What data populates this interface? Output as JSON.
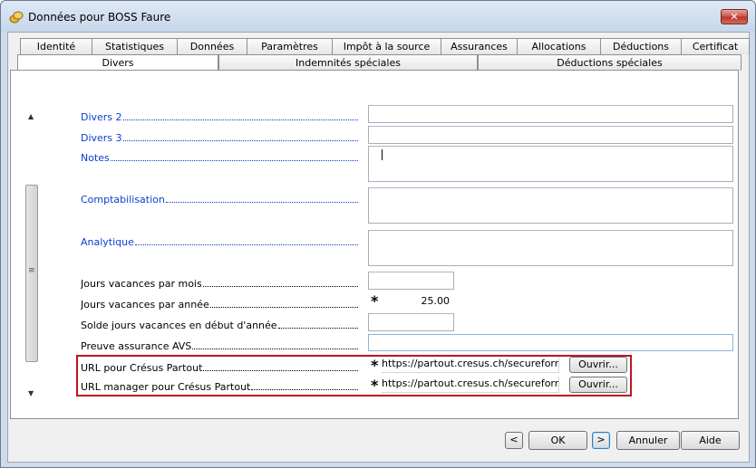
{
  "window": {
    "title": "Données pour BOSS Faure",
    "close_label": "✕"
  },
  "tabs_row1": [
    {
      "label": "Identité"
    },
    {
      "label": "Statistiques"
    },
    {
      "label": "Données"
    },
    {
      "label": "Paramètres"
    },
    {
      "label": "Impôt à la source"
    },
    {
      "label": "Assurances"
    },
    {
      "label": "Allocations"
    },
    {
      "label": "Déductions"
    },
    {
      "label": "Certificat"
    }
  ],
  "tabs_row2": [
    {
      "label": "Divers",
      "active": true
    },
    {
      "label": "Indemnités spéciales"
    },
    {
      "label": "Déductions spéciales"
    }
  ],
  "fields": {
    "divers2": {
      "label": "Divers 2",
      "value": ""
    },
    "divers3": {
      "label": "Divers 3",
      "value": ""
    },
    "notes": {
      "label": "Notes",
      "value": ""
    },
    "comptabilisation": {
      "label": "Comptabilisation",
      "value": ""
    },
    "analytique": {
      "label": "Analytique",
      "value": ""
    },
    "jours_mois": {
      "label": "Jours vacances par mois",
      "value": ""
    },
    "jours_annee": {
      "label": "Jours vacances par année",
      "value": "25.00",
      "marker": "*"
    },
    "solde": {
      "label": "Solde jours vacances en début d'année",
      "value": ""
    },
    "preuve": {
      "label": "Preuve assurance AVS",
      "value": ""
    },
    "url_partout": {
      "label": "URL pour Crésus Partout",
      "value": "https://partout.cresus.ch/secureforms",
      "marker": "*",
      "button": "Ouvrir..."
    },
    "url_manager": {
      "label": "URL manager pour Crésus Partout",
      "value": "https://partout.cresus.ch/secureforms",
      "marker": "*",
      "button": "Ouvrir..."
    }
  },
  "scrollbar": {
    "up": "▲",
    "down": "▼",
    "grip": "≡"
  },
  "footer": {
    "prev": "<",
    "ok": "OK",
    "next": ">",
    "cancel": "Annuler",
    "help": "Aide"
  },
  "colors": {
    "link_blue": "#0b3dcf",
    "highlight_red": "#c1121f",
    "close_red": "#c75050"
  }
}
